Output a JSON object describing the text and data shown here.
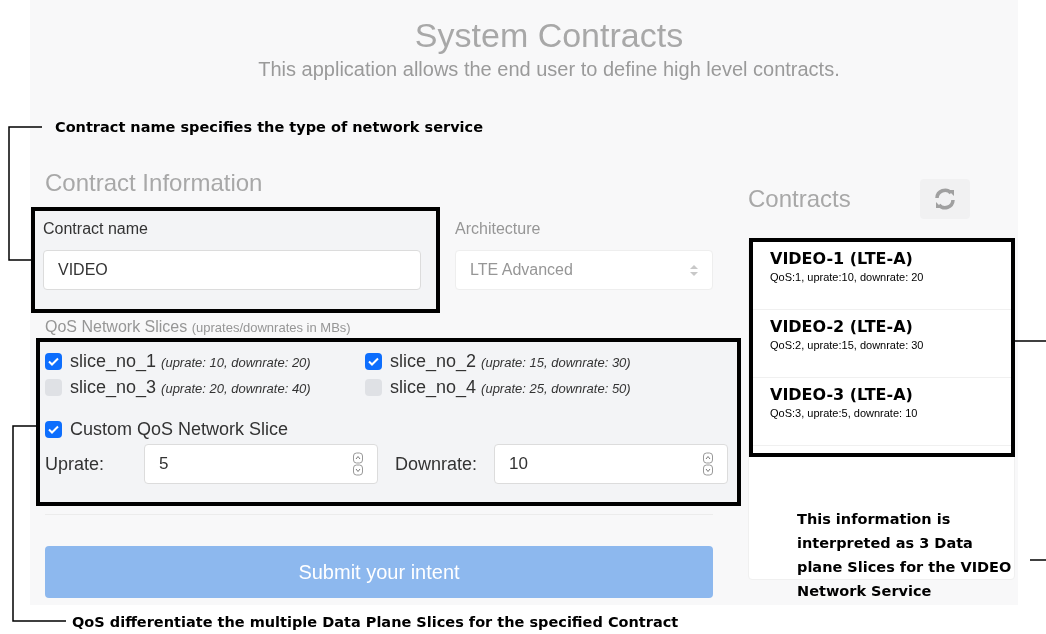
{
  "app": {
    "title": "System Contracts",
    "subtitle": "This application allows the end user to define high level contracts."
  },
  "form": {
    "heading": "Contract Information",
    "contract_name": {
      "label": "Contract name",
      "value": "VIDEO"
    },
    "architecture": {
      "label": "Architecture",
      "value": "LTE Advanced"
    },
    "slices_heading": "QoS Network Slices",
    "slices_hint": "(uprates/downrates in MBs)",
    "slices": [
      {
        "name": "slice_no_1",
        "detail": "(uprate: 10, downrate: 20)",
        "checked": true
      },
      {
        "name": "slice_no_2",
        "detail": "(uprate: 15, downrate: 30)",
        "checked": true
      },
      {
        "name": "slice_no_3",
        "detail": "(uprate: 20, downrate: 40)",
        "checked": false
      },
      {
        "name": "slice_no_4",
        "detail": "(uprate: 25, downrate: 50)",
        "checked": false
      }
    ],
    "custom": {
      "label": "Custom QoS Network Slice",
      "checked": true
    },
    "uprate": {
      "label": "Uprate:",
      "value": "5"
    },
    "downrate": {
      "label": "Downrate:",
      "value": "10"
    },
    "submit": {
      "label": "Submit your intent",
      "disabled": true
    }
  },
  "contracts": {
    "heading": "Contracts",
    "items": [
      {
        "title": "VIDEO-1 (LTE-A)",
        "detail": "QoS:1, uprate:10, downrate: 20"
      },
      {
        "title": "VIDEO-2 (LTE-A)",
        "detail": "QoS:2, uprate:15, downrate: 30"
      },
      {
        "title": "VIDEO-3 (LTE-A)",
        "detail": "QoS:3, uprate:5, downrate: 10"
      }
    ]
  },
  "annotations": [
    {
      "kind": "contract-name",
      "text": "Contract name specifies the type of network service"
    },
    {
      "kind": "contracts",
      "text": "This information is interpreted as 3 Data plane Slices for the VIDEO Network Service"
    },
    {
      "kind": "slices",
      "text": "QoS differentiate the multiple Data Plane Slices for the specified Contract"
    }
  ]
}
